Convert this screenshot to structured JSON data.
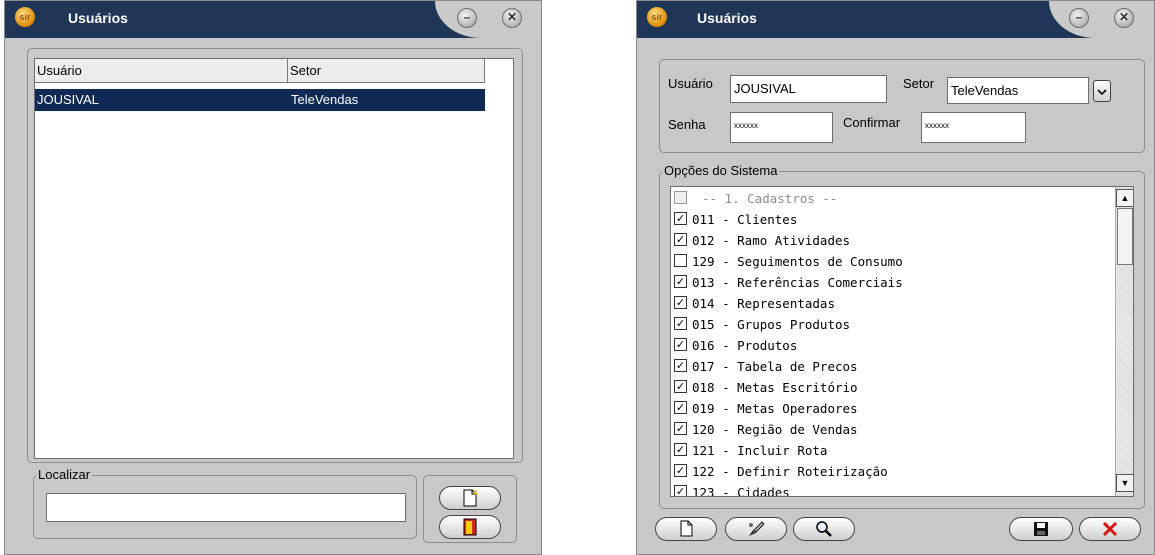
{
  "left_window": {
    "title": "Usuários",
    "logo_text": "sir",
    "columns": [
      "Usuário",
      "Setor"
    ],
    "rows": [
      {
        "usuario": "JOUSIVAL",
        "setor": "TeleVendas"
      }
    ],
    "search_label": "Localizar",
    "search_value": "",
    "buttons": {
      "new_icon": "new-document-icon",
      "exit_icon": "exit-door-icon"
    }
  },
  "right_window": {
    "title": "Usuários",
    "logo_text": "sir",
    "usuario_label": "Usuário",
    "usuario_value": "JOUSIVAL",
    "setor_label": "Setor",
    "setor_value": "TeleVendas",
    "senha_label": "Senha",
    "senha_value": "xxxxxx",
    "confirmar_label": "Confirmar",
    "confirmar_value": "xxxxxx",
    "options_legend": "Opções do Sistema",
    "options": [
      {
        "text": "-- 1. Cadastros --",
        "checked": false,
        "header": true
      },
      {
        "text": "011 - Clientes",
        "checked": true
      },
      {
        "text": "012 - Ramo Atividades",
        "checked": true
      },
      {
        "text": "129 - Seguimentos de Consumo",
        "checked": false
      },
      {
        "text": "013 - Referências Comerciais",
        "checked": true
      },
      {
        "text": "014 - Representadas",
        "checked": true
      },
      {
        "text": "015 - Grupos Produtos",
        "checked": true
      },
      {
        "text": "016 - Produtos",
        "checked": true
      },
      {
        "text": "017 - Tabela de Precos",
        "checked": true
      },
      {
        "text": "018 - Metas Escritório",
        "checked": true
      },
      {
        "text": "019 - Metas Operadores",
        "checked": true
      },
      {
        "text": "120 - Região de Vendas",
        "checked": true
      },
      {
        "text": "121 - Incluir Rota",
        "checked": true
      },
      {
        "text": "122 - Definir Roteirização",
        "checked": true
      },
      {
        "text": "123 - Cidades",
        "checked": true
      }
    ],
    "toolbar_icons": [
      "new-document-icon",
      "edit-brush-icon",
      "search-icon",
      "save-disk-icon",
      "cancel-x-icon"
    ]
  }
}
